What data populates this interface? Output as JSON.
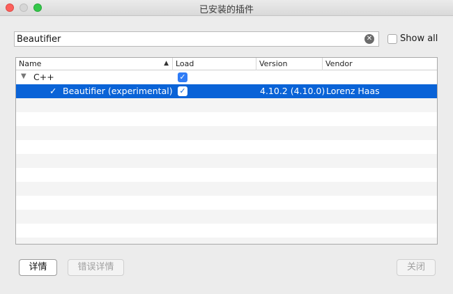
{
  "window": {
    "title": "已安装的插件"
  },
  "filter": {
    "value": "Beautifier",
    "clear_icon": "✕"
  },
  "show_all": {
    "label": "Show all",
    "checked": false
  },
  "table": {
    "columns": {
      "name": "Name",
      "load": "Load",
      "version": "Version",
      "vendor": "Vendor"
    },
    "sort_indicator": "▲",
    "category": {
      "expander": "▼",
      "name": "C++",
      "load_check": "✓"
    },
    "plugin": {
      "status_check": "✓",
      "name": "Beautifier (experimental)",
      "load_check": "✓",
      "version": "4.10.2 (4.10.0)",
      "vendor": "Lorenz Haas"
    }
  },
  "buttons": {
    "details": "详情",
    "error_details": "错误详情",
    "close": "关闭"
  },
  "colors": {
    "selection": "#0a63d7",
    "checkbox": "#2f7cf6"
  }
}
